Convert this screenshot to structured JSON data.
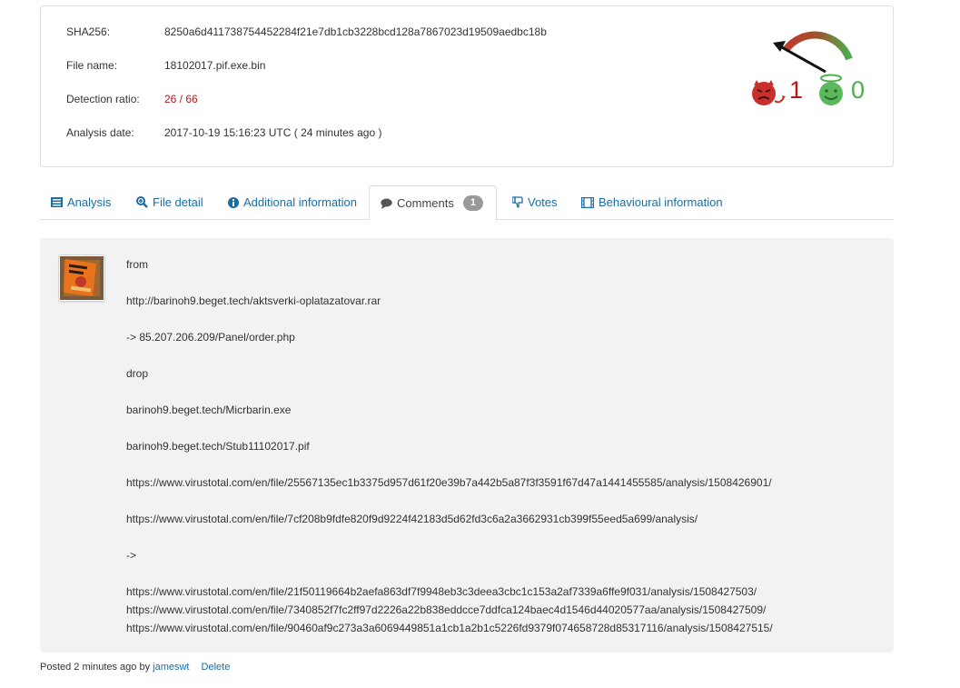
{
  "summary": {
    "sha256_label": "SHA256:",
    "sha256_value": "8250a6d411738754452284f21e7db1cb3228bcd128a7867023d19509aedbc18b",
    "filename_label": "File name:",
    "filename_value": "18102017.pif.exe.bin",
    "detection_label": "Detection ratio:",
    "detection_value": "26 / 66",
    "date_label": "Analysis date:",
    "date_value": "2017-10-19 15:16:23 UTC ( 24 minutes ago )",
    "votes_malicious": "1",
    "votes_harmless": "0",
    "colors": {
      "malicious": "#b11a1a",
      "harmless": "#4cae4c",
      "link": "#1a6ea5"
    }
  },
  "tabs": [
    {
      "label": "Analysis",
      "icon": "list-icon"
    },
    {
      "label": "File detail",
      "icon": "zoom-icon"
    },
    {
      "label": "Additional information",
      "icon": "info-icon"
    },
    {
      "label": "Comments",
      "icon": "comment-icon",
      "badge": "1",
      "active": true
    },
    {
      "label": "Votes",
      "icon": "thumbs-down-icon"
    },
    {
      "label": "Behavioural information",
      "icon": "film-icon"
    }
  ],
  "comment": {
    "lines": [
      "from",
      "http://barinoh9.beget.tech/aktsverki-oplatazatovar.rar",
      "-> 85.207.206.209/Panel/order.php",
      "drop",
      "barinoh9.beget.tech/Micrbarin.exe",
      "barinoh9.beget.tech/Stub11102017.pif",
      "https://www.virustotal.com/en/file/25567135ec1b3375d957d61f20e39b7a442b5a87f3f3591f67d47a1441455585/analysis/1508426901/",
      "https://www.virustotal.com/en/file/7cf208b9fdfe820f9d9224f42183d5d62fd3c6a2a3662931cb399f55eed5a699/analysis/",
      "->",
      "https://www.virustotal.com/en/file/21f50119664b2aefa863df7f9948eb3c3deea3cbc1c153a2af7339a6ffe9f031/analysis/1508427503/",
      "https://www.virustotal.com/en/file/7340852f7fc2ff97d2226a22b838eddcce7ddfca124baec4d1546d44020577aa/analysis/1508427509/",
      "https://www.virustotal.com/en/file/90460af9c273a3a6069449851a1cb1a2b1c5226fd9379f074658728d85317116/analysis/1508427515/"
    ],
    "posted_prefix": "Posted 2 minutes ago by",
    "author": "jameswt",
    "delete_label": "Delete"
  }
}
